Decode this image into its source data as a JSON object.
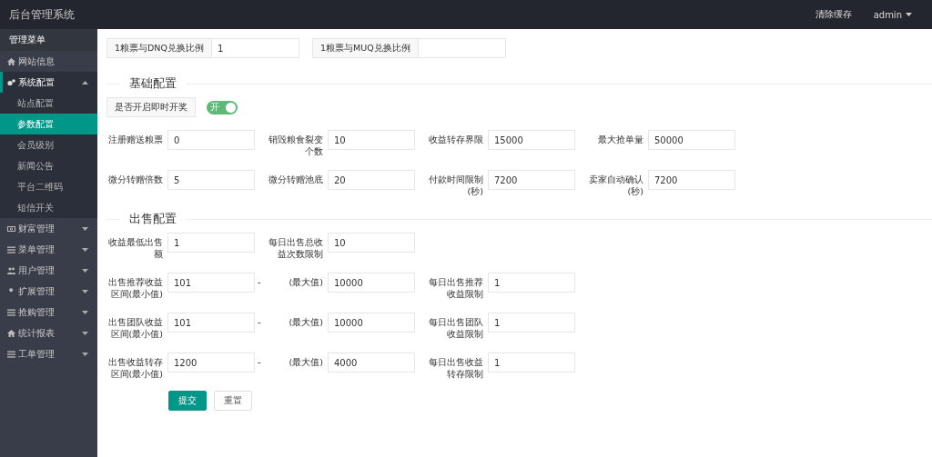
{
  "header": {
    "title": "后台管理系统",
    "links": [
      {
        "label": "清除缓存",
        "dropdown": false
      },
      {
        "label": "admin",
        "dropdown": true
      }
    ]
  },
  "sidebar": {
    "heading": "管理菜单",
    "items": [
      {
        "label": "网站信息"
      },
      {
        "label": "系统配置",
        "expanded": true,
        "children": [
          {
            "label": "站点配置",
            "selected": false
          },
          {
            "label": "参数配置",
            "selected": true
          },
          {
            "label": "会员级别",
            "selected": false
          },
          {
            "label": "新闻公告",
            "selected": false
          },
          {
            "label": "平台二维码",
            "selected": false
          },
          {
            "label": "短信开关",
            "selected": false
          }
        ]
      },
      {
        "label": "财富管理",
        "expanded": false
      },
      {
        "label": "菜单管理",
        "expanded": false
      },
      {
        "label": "用户管理",
        "expanded": false
      },
      {
        "label": "扩展管理",
        "expanded": false
      },
      {
        "label": "抢购管理",
        "expanded": false
      },
      {
        "label": "统计报表",
        "expanded": false
      },
      {
        "label": "工单管理",
        "expanded": false
      }
    ]
  },
  "top_fields": [
    {
      "label": "1粮票与DNQ兑换比例",
      "value": "1"
    },
    {
      "label": "1粮票与MUQ兑换比例"
    }
  ],
  "basic": {
    "legend": "基础配置",
    "toggle": {
      "label": "是否开启即时开奖",
      "on": true,
      "text": "开"
    },
    "rows": [
      [
        {
          "label": "注册赠送粮票",
          "value": "0"
        },
        {
          "label": "销毁粮食裂变个数",
          "value": "10"
        },
        {
          "label": "收益转存界限",
          "value": "15000"
        },
        {
          "label": "最大抢单量",
          "value": "50000"
        }
      ],
      [
        {
          "label": "微分转赠倍数",
          "value": "5"
        },
        {
          "label": "微分转赠池底",
          "value": "20"
        },
        {
          "label": "付款时间限制(秒)",
          "value": "7200"
        },
        {
          "label": "卖家自动确认(秒)",
          "value": "7200"
        }
      ]
    ]
  },
  "sale": {
    "legend": "出售配置",
    "rows": [
      [
        {
          "label": "收益最低出售额",
          "value": "1"
        },
        {
          "label": "每日出售总收益次数限制",
          "value": "10"
        }
      ],
      [
        {
          "label": "出售推荐收益区间(最小值)",
          "value": "101"
        },
        {
          "separator": "-",
          "label": "(最大值)",
          "value": "10000"
        },
        {
          "label": "每日出售推荐收益限制",
          "value": "1"
        }
      ],
      [
        {
          "label": "出售团队收益区间(最小值)",
          "value": "101"
        },
        {
          "separator": "-",
          "label": "(最大值)",
          "value": "10000"
        },
        {
          "label": "每日出售团队收益限制",
          "value": "1"
        }
      ],
      [
        {
          "label": "出售收益转存区间(最小值)",
          "value": "1200"
        },
        {
          "separator": "-",
          "label": "(最大值)",
          "value": "4000"
        },
        {
          "label": "每日出售收益转存限制",
          "value": "1"
        }
      ]
    ]
  },
  "buttons": [
    {
      "label": "提交",
      "kind": "primary"
    },
    {
      "label": "重置",
      "kind": "plain"
    }
  ]
}
